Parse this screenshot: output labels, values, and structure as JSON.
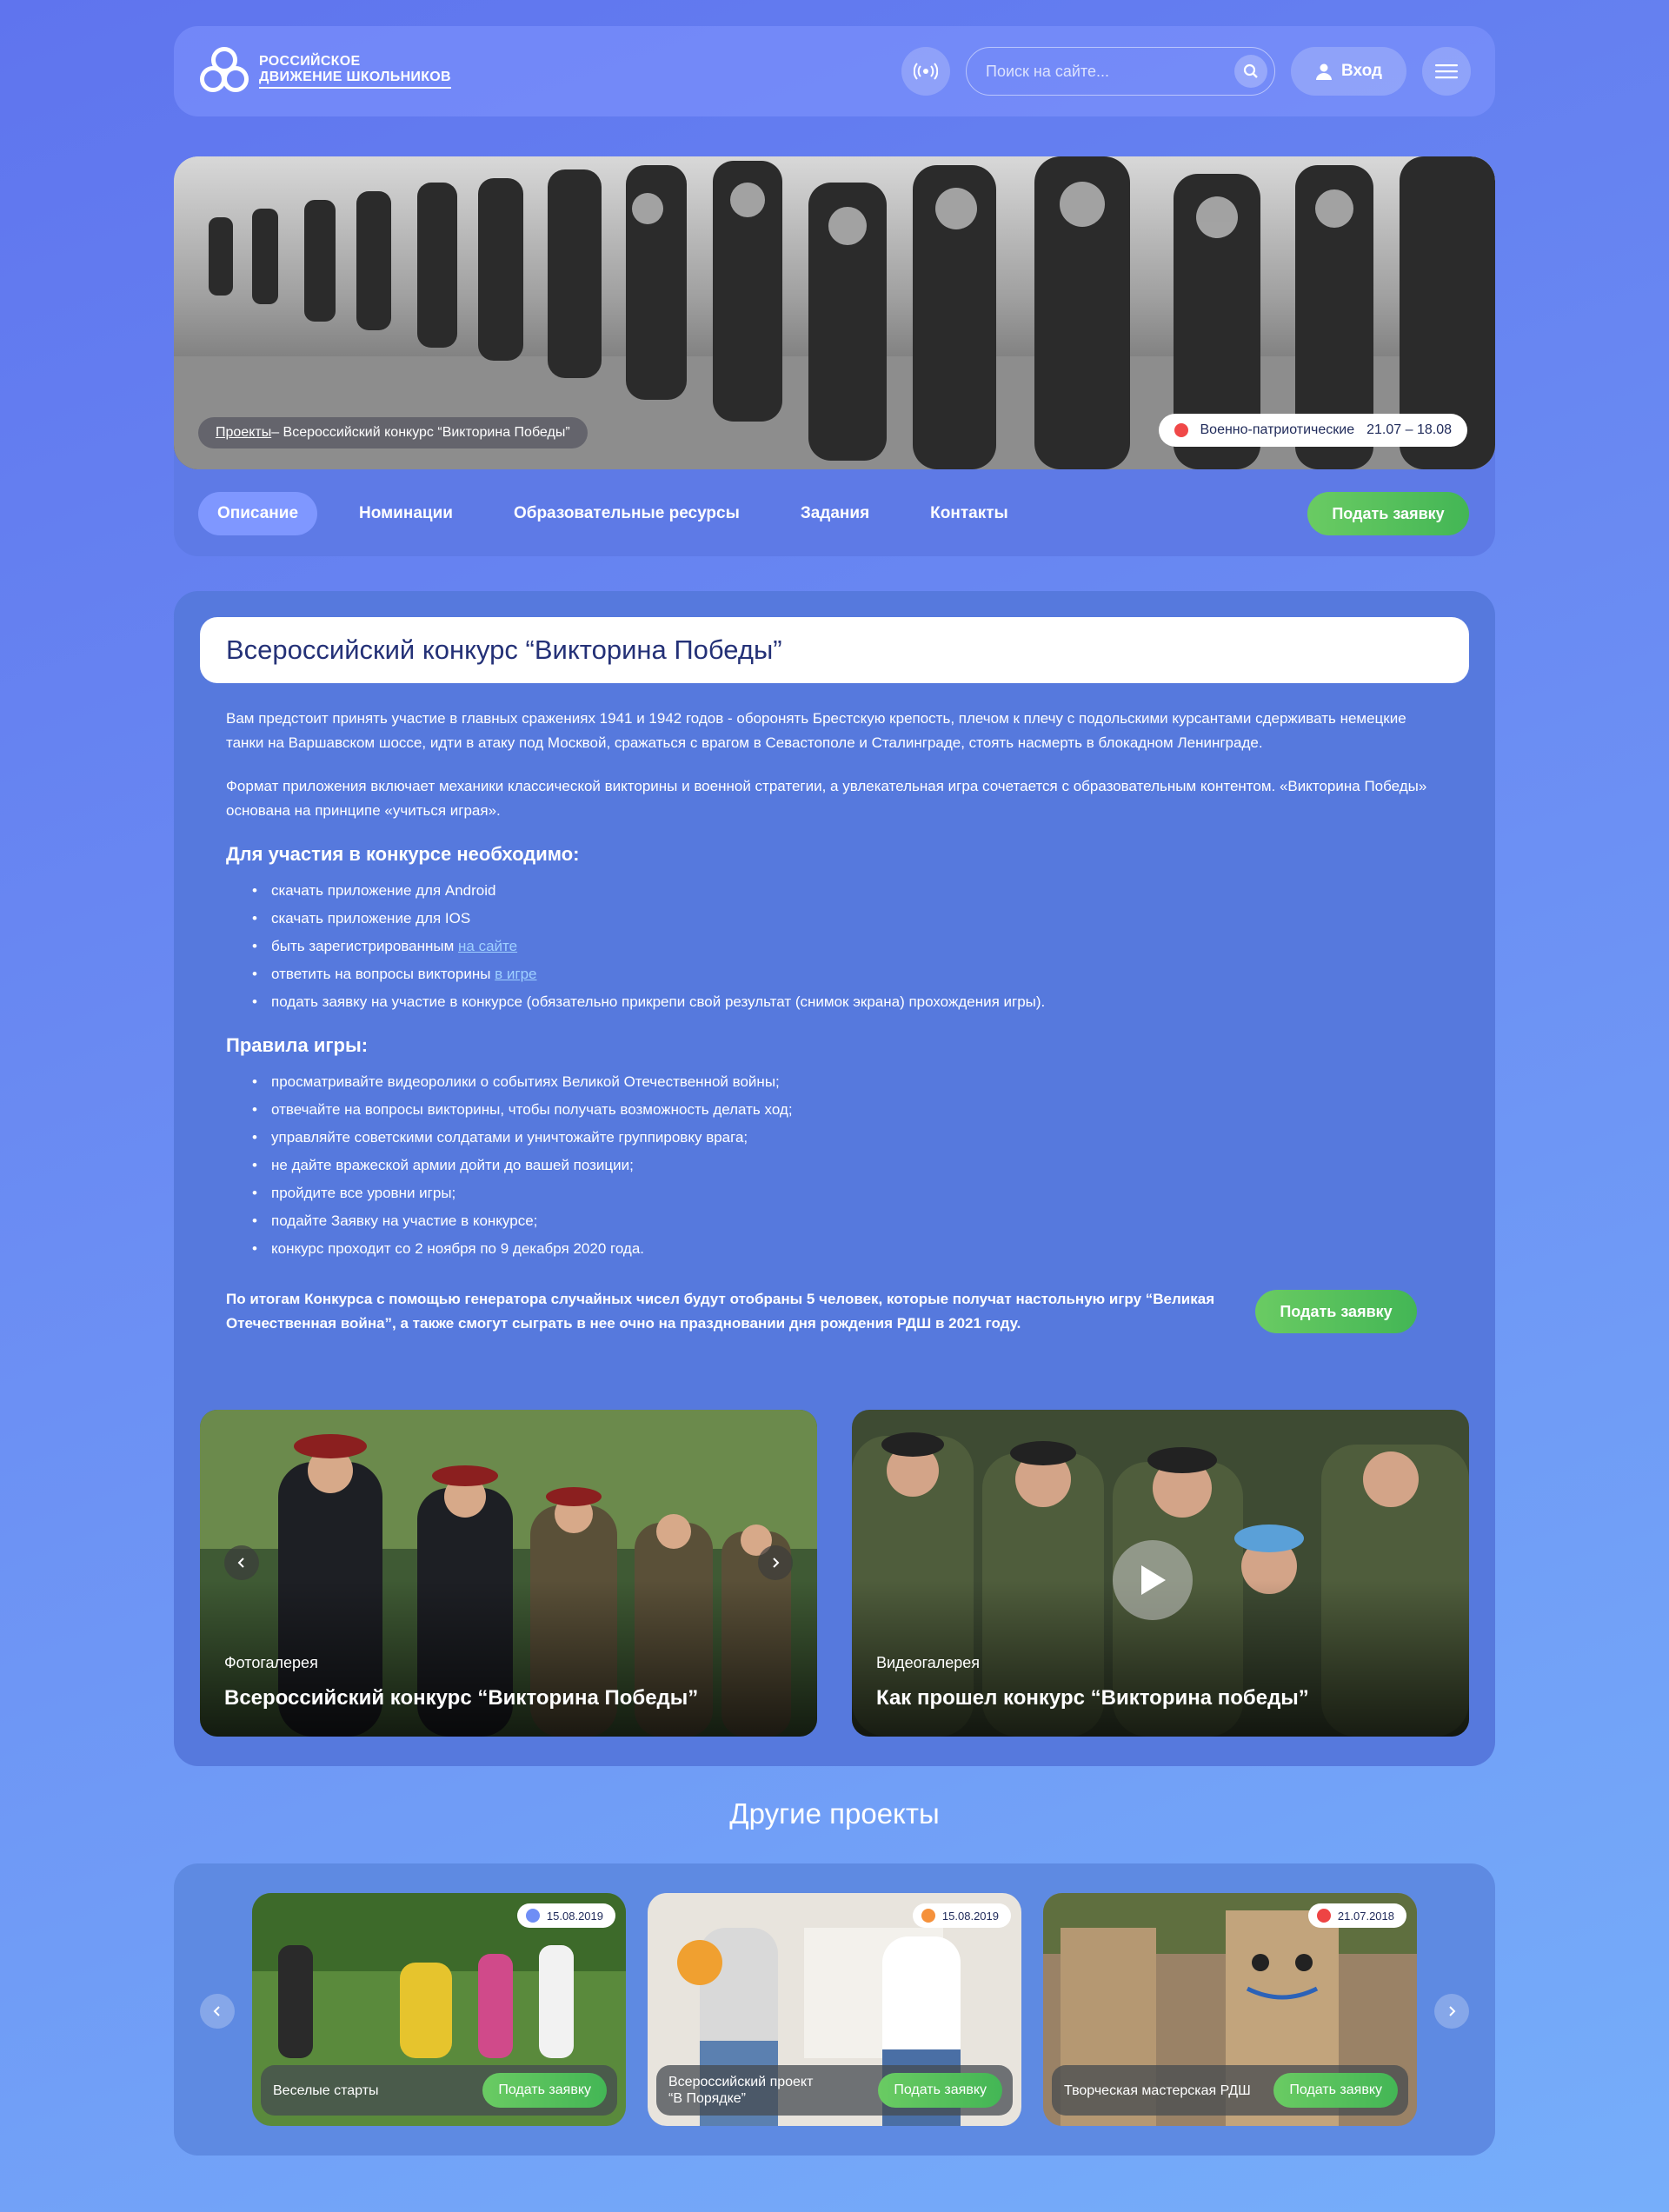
{
  "header": {
    "logo_line1": "Российское",
    "logo_line2": "движение школьников",
    "search_placeholder": "Поиск на сайте...",
    "login_label": "Вход"
  },
  "hero": {
    "breadcrumb_link": "Проекты",
    "breadcrumb_rest": " – Всероссийский конкурс “Викторина Победы”",
    "tag_label": "Военно-патриотические",
    "tag_dates": "21.07 – 18.08",
    "tag_color": "#f04848",
    "tabs": [
      {
        "label": "Описание"
      },
      {
        "label": "Номинации"
      },
      {
        "label": "Образовательные ресурсы"
      },
      {
        "label": "Задания"
      },
      {
        "label": "Контакты"
      }
    ],
    "apply_label": "Подать заявку"
  },
  "main": {
    "title": "Всероссийский конкурс “Викторина Победы”",
    "para1": "Вам предстоит принять участие в главных сражениях 1941 и 1942 годов - оборонять Брестскую крепость, плечом к плечу с подольскими курсантами сдерживать немецкие танки на Варшавском шоссе, идти в атаку под Москвой, сражаться с врагом в Севастополе и Сталинграде, стоять насмерть в блокадном Ленинграде.",
    "para2": "Формат приложения включает механики классической викторины и военной стратегии, а увлекательная игра сочетается с образовательным контентом. «Викторина Победы» основана на принципе «учиться играя».",
    "req_heading": "Для участия в конкурсе необходимо:",
    "req_items": [
      "скачать приложение для Android",
      "скачать приложение для IOS",
      "быть зарегистрированным ",
      "ответить на вопросы викторины ",
      "подать заявку на участие в конкурсе (обязательно прикрепи свой результат (снимок экрана) прохождения игры)."
    ],
    "req_link_site": "на сайте",
    "req_link_game": "в игре",
    "rules_heading": "Правила игры:",
    "rules_items": [
      "просматривайте видеоролики о событиях Великой Отечественной войны;",
      "отвечайте на вопросы викторины, чтобы получать возможность делать ход;",
      "управляйте советскими солдатами и уничтожайте группировку врага;",
      "не дайте вражеской армии дойти до вашей позиции;",
      "пройдите все уровни игры;",
      "подайте Заявку на участие в конкурсе;",
      "конкурс проходит со 2 ноября по 9 декабря 2020 года."
    ],
    "outro": "По итогам Конкурса с помощью генератора случайных чисел будут отобраны 5 человек, которые получат настольную игру “Великая Отечественная война”, а также смогут сыграть в нее очно на праздновании дня рождения РДШ в 2021 году.",
    "apply_label": "Подать заявку",
    "photo_kind": "Фотогалерея",
    "photo_title": "Всероссийский конкурс “Викторина Победы”",
    "video_kind": "Видеогалерея",
    "video_title": "Как прошел конкурс “Викторина победы”"
  },
  "other": {
    "heading": "Другие проекты",
    "projects": [
      {
        "date": "15.08.2019",
        "dot": "#6f8ef5",
        "name": "Веселые старты",
        "btn": "Подать заявку"
      },
      {
        "date": "15.08.2019",
        "dot": "#f5913b",
        "name": "Всероссийский проект\n“В Порядке”",
        "btn": "Подать заявку"
      },
      {
        "date": "21.07.2018",
        "dot": "#ee4444",
        "name": "Творческая мастерская РДШ",
        "btn": "Подать заявку"
      }
    ]
  }
}
